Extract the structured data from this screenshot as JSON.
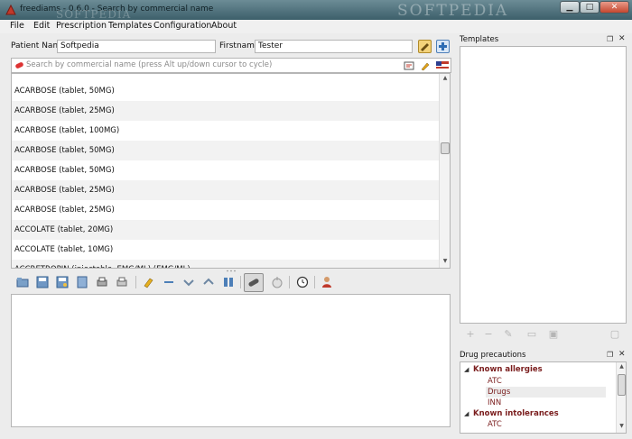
{
  "window": {
    "title": "freediams - 0.6.0 - Search by commercial name",
    "watermark": "SOFTPEDIA",
    "watermark2": "SOFTPEDIA",
    "controls": {
      "minimize": "▁",
      "maximize": "□",
      "close": "✕"
    }
  },
  "menu": [
    "File",
    "Edit",
    "Prescription",
    "Templates",
    "Configuration",
    "About"
  ],
  "patient": {
    "name_label": "Patient Name",
    "name_value": "Softpedia",
    "firstname_label": "Firstname",
    "firstname_value": "Tester"
  },
  "search": {
    "placeholder": "Search by commercial name (press Alt up/down cursor to cycle)",
    "lang_flag": "flag-icon"
  },
  "drug_list": {
    "partial_top": "ACARBOSE (tablet, 50MG)",
    "items": [
      "ACARBOSE (tablet, 50MG)",
      "ACARBOSE (tablet, 25MG)",
      "ACARBOSE (tablet, 100MG)",
      "ACARBOSE (tablet, 50MG)",
      "ACARBOSE (tablet, 50MG)",
      "ACARBOSE (tablet, 25MG)",
      "ACARBOSE (tablet, 25MG)",
      "ACCOLATE (tablet, 20MG)",
      "ACCOLATE (tablet, 10MG)"
    ],
    "partial_bottom": "ACCRETROPIN (injectable, EMG/ML) (EMG/ML)",
    "scroll_position": 0.35
  },
  "templates_dock": {
    "title": "Templates"
  },
  "precautions_dock": {
    "title": "Drug precautions",
    "tree": [
      {
        "label": "Known allergies",
        "children": [
          "ATC",
          "Drugs",
          "INN"
        ]
      },
      {
        "label": "Known intolerances",
        "children": [
          "ATC"
        ]
      }
    ],
    "selected": "Drugs"
  },
  "colors": {
    "titlebar": "#4e727c",
    "precaution_text": "#7a1d1d",
    "row_alt": "#f2f2f2"
  }
}
